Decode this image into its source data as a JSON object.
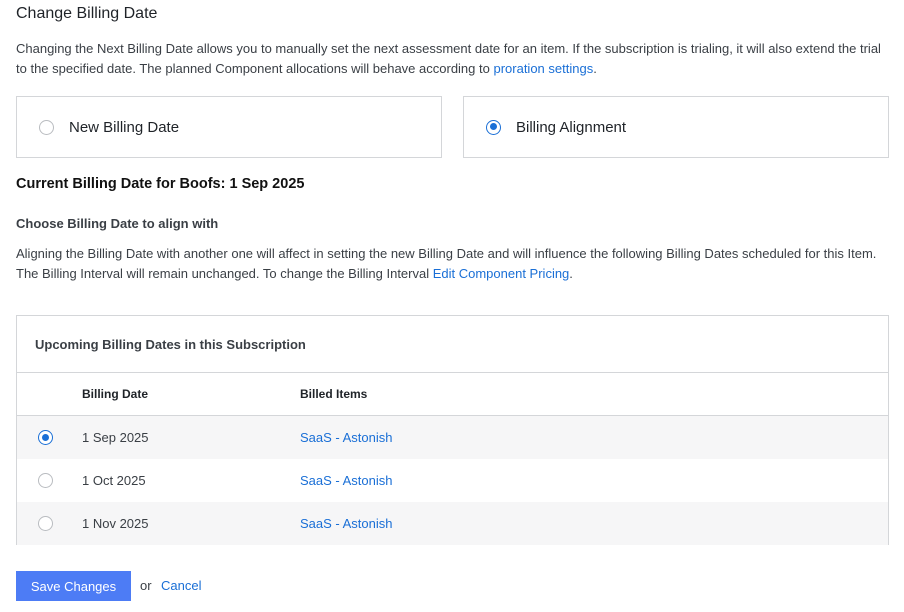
{
  "header": {
    "title": "Change Billing Date",
    "description_main": "Changing the Next Billing Date allows you to manually set the next assessment date for an item. If the subscription is trialing, it will also extend the trial to the specified date. The planned Component allocations will behave according to ",
    "description_link": "proration settings",
    "description_end": "."
  },
  "options": [
    {
      "label": "New Billing Date",
      "selected": false
    },
    {
      "label": "Billing Alignment",
      "selected": true
    }
  ],
  "current_billing": "Current Billing Date for Boofs: 1 Sep 2025",
  "align": {
    "heading": "Choose Billing Date to align with",
    "line1": "Aligning the Billing Date with another one will affect in setting the new Billing Date and will influence the following Billing Dates scheduled for this Item.",
    "line2": "The Billing Interval will remain unchanged. To change the Billing Interval ",
    "line2_link": "Edit Component Pricing",
    "line2_end": "."
  },
  "table": {
    "title": "Upcoming Billing Dates in this Subscription",
    "columns": {
      "billing_date": "Billing Date",
      "billed_items": "Billed Items"
    },
    "rows": [
      {
        "date": "1 Sep 2025",
        "item": "SaaS - Astonish",
        "selected": true
      },
      {
        "date": "1 Oct 2025",
        "item": "SaaS - Astonish",
        "selected": false
      },
      {
        "date": "1 Nov 2025",
        "item": "SaaS - Astonish",
        "selected": false
      }
    ]
  },
  "actions": {
    "save": "Save Changes",
    "or": "or",
    "cancel": "Cancel"
  },
  "colors": {
    "accent": "#1a6fd6",
    "button": "#4d7cf5"
  }
}
